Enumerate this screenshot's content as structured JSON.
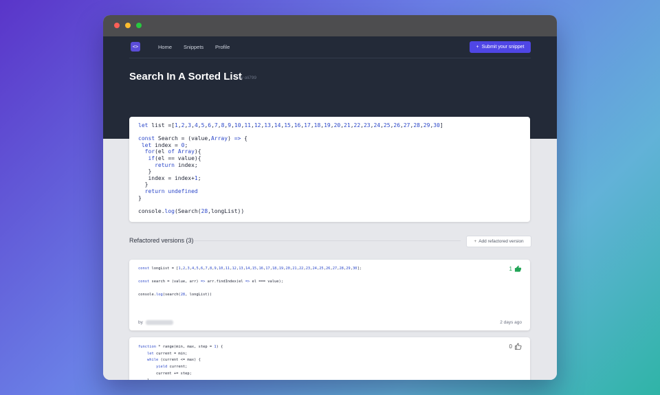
{
  "nav": {
    "logo_glyph": "<>",
    "links": [
      "Home",
      "Snippets",
      "Profile"
    ],
    "submit_label": "Submit your snippet",
    "plus": "+"
  },
  "snippet": {
    "title": "Search In A Sorted List",
    "byline": "by oli799"
  },
  "refactored": {
    "section_label": "Refactored versions (3)",
    "add_label": "Add refactored version",
    "items": [
      {
        "votes": "1",
        "vote_icon": "thumbs-up-filled-icon",
        "by": "by",
        "date": "2 days ago"
      },
      {
        "votes": "0",
        "vote_icon": "thumbs-up-outline-icon"
      }
    ]
  },
  "colors": {
    "accent": "#4f46e5",
    "hero_bg": "#232a38",
    "upvote_green": "#21a456",
    "keyword_blue": "#2b47c9"
  }
}
